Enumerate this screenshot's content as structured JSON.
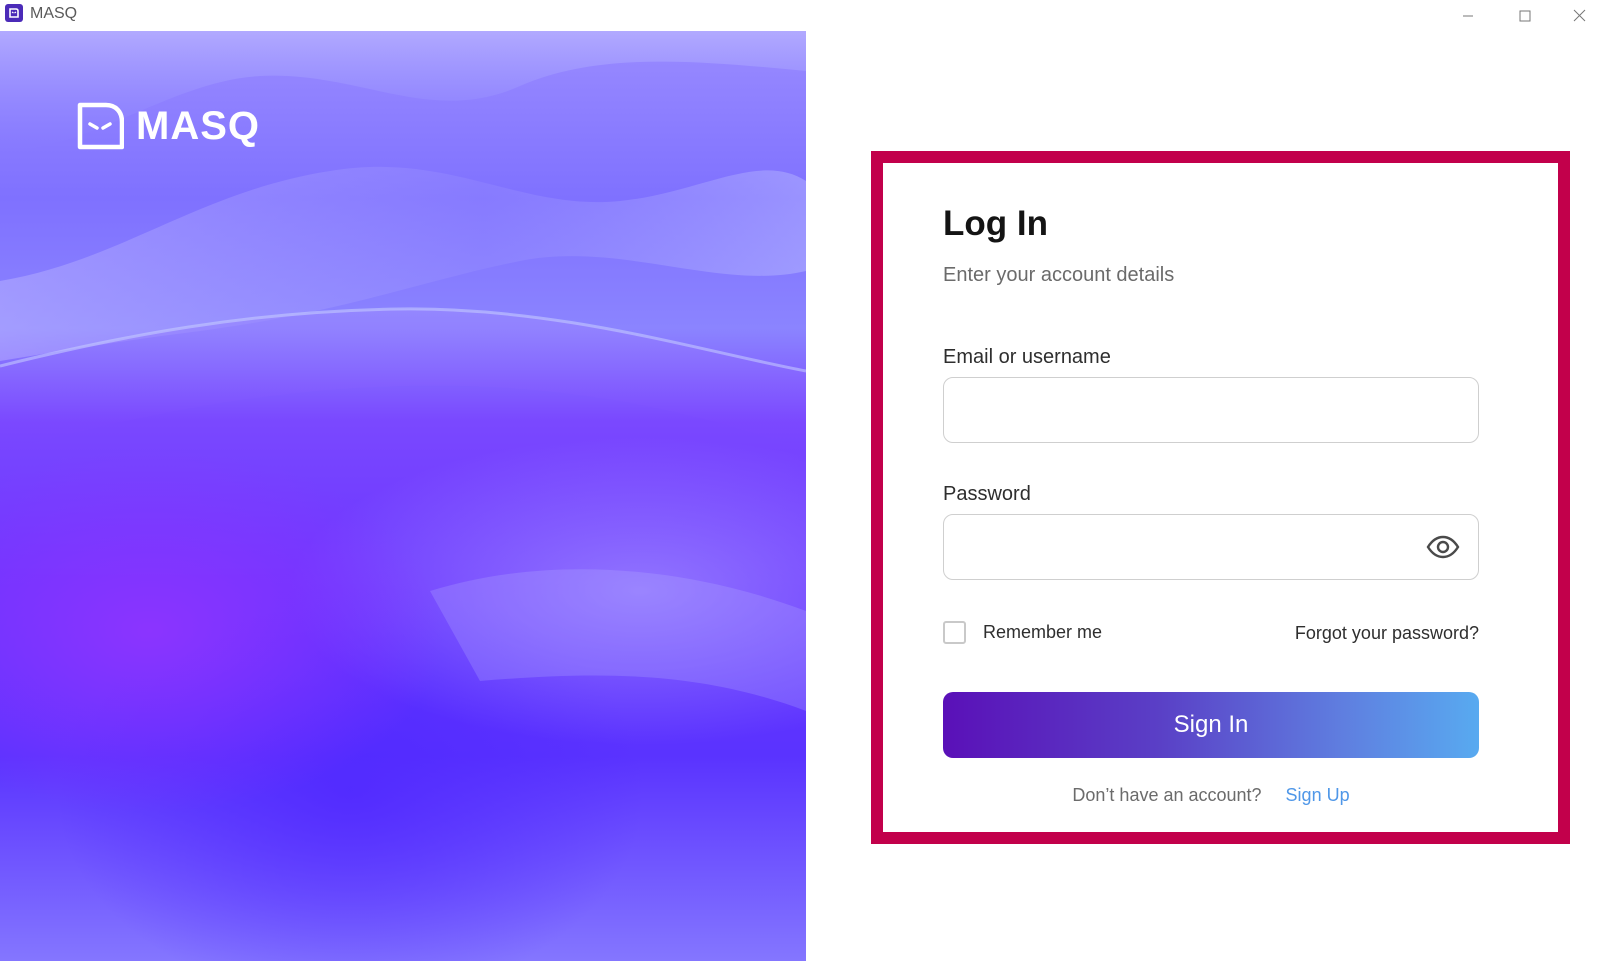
{
  "window": {
    "title": "MASQ",
    "app_icon": "masq-app-icon",
    "controls": [
      "minimize-icon",
      "maximize-icon",
      "close-icon"
    ]
  },
  "hero": {
    "brand_name": "MASQ",
    "logo_icon": "masq-ghost-icon"
  },
  "login": {
    "title": "Log In",
    "subtitle": "Enter your account details",
    "email_label": "Email or username",
    "email_value": "",
    "password_label": "Password",
    "password_value": "",
    "password_toggle_icon": "eye-icon",
    "remember_label": "Remember me",
    "remember_checked": false,
    "forgot_label": "Forgot your password?",
    "signin_label": "Sign In",
    "signup_prompt": "Don’t have an account?",
    "signup_link": "Sign Up"
  },
  "colors": {
    "highlight_border": "#c2004b",
    "signin_gradient_start": "#5a10b8",
    "signin_gradient_end": "#58aaf0",
    "link": "#4f97e8",
    "hero_purple": "#6a34ff"
  }
}
